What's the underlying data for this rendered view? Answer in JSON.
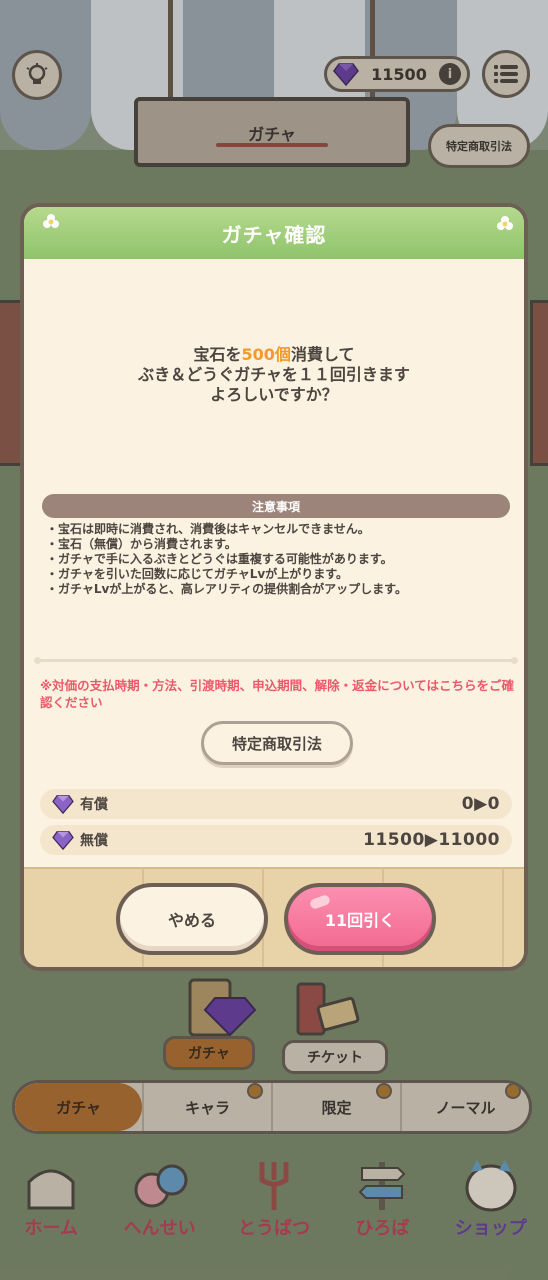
{
  "colors": {
    "header_green": "#8fc46c",
    "highlight_orange": "#f19a2c",
    "warning_red": "#ea5a6b",
    "draw_pink": "#f2698f",
    "border_brown": "#6e5f55"
  },
  "header": {
    "gem_count": "11500",
    "sign_title": "ガチャ",
    "law_button": "特定商取引法",
    "icons": [
      "lightbulb-icon",
      "menu-list-icon",
      "gem-icon",
      "info-icon"
    ]
  },
  "dialog": {
    "title": "ガチャ確認",
    "message": {
      "line1_prefix": "宝石を",
      "line1_highlight": "500個",
      "line1_suffix": "消費して",
      "line2": "ぶき＆どうぐガチャを１１回引きます",
      "line3": "よろしいですか？"
    },
    "notice_title": "注意事項",
    "notices": [
      "・宝石は即時に消費され、消費後はキャンセルできません。",
      "・宝石（無償）から消費されます。",
      "・ガチャで手に入るぶきとどうぐは重複する可能性があります。",
      "・ガチャを引いた回数に応じてガチャLvが上がります。",
      "・ガチャLvが上がると、高レアリティの提供割合がアップします。"
    ],
    "warning": "※対価の支払時期・方法、引渡時期、申込期間、解除・返金についてはこちらをご確認ください",
    "law_button": "特定商取引法",
    "paid": {
      "label": "有償",
      "value": "0▶0"
    },
    "free": {
      "label": "無償",
      "value": "11500▶11000"
    },
    "cancel_button": "やめる",
    "draw_button": "11回引く"
  },
  "shop": {
    "category_tags": [
      "ガチャ",
      "チケット"
    ],
    "tabs": [
      "ガチャ",
      "キャラ",
      "限定",
      "ノーマル"
    ]
  },
  "bottom_nav": [
    {
      "label": "ホーム",
      "icon": "home-icon",
      "color": "#c0415a"
    },
    {
      "label": "へんせい",
      "icon": "characters-icon",
      "color": "#c0415a"
    },
    {
      "label": "とうばつ",
      "icon": "fork-weapon-icon",
      "color": "#c0415a"
    },
    {
      "label": "ひろば",
      "icon": "signpost-icon",
      "color": "#c0415a"
    },
    {
      "label": "ショップ",
      "icon": "shop-cat-icon",
      "color": "#6a3fa3"
    }
  ]
}
